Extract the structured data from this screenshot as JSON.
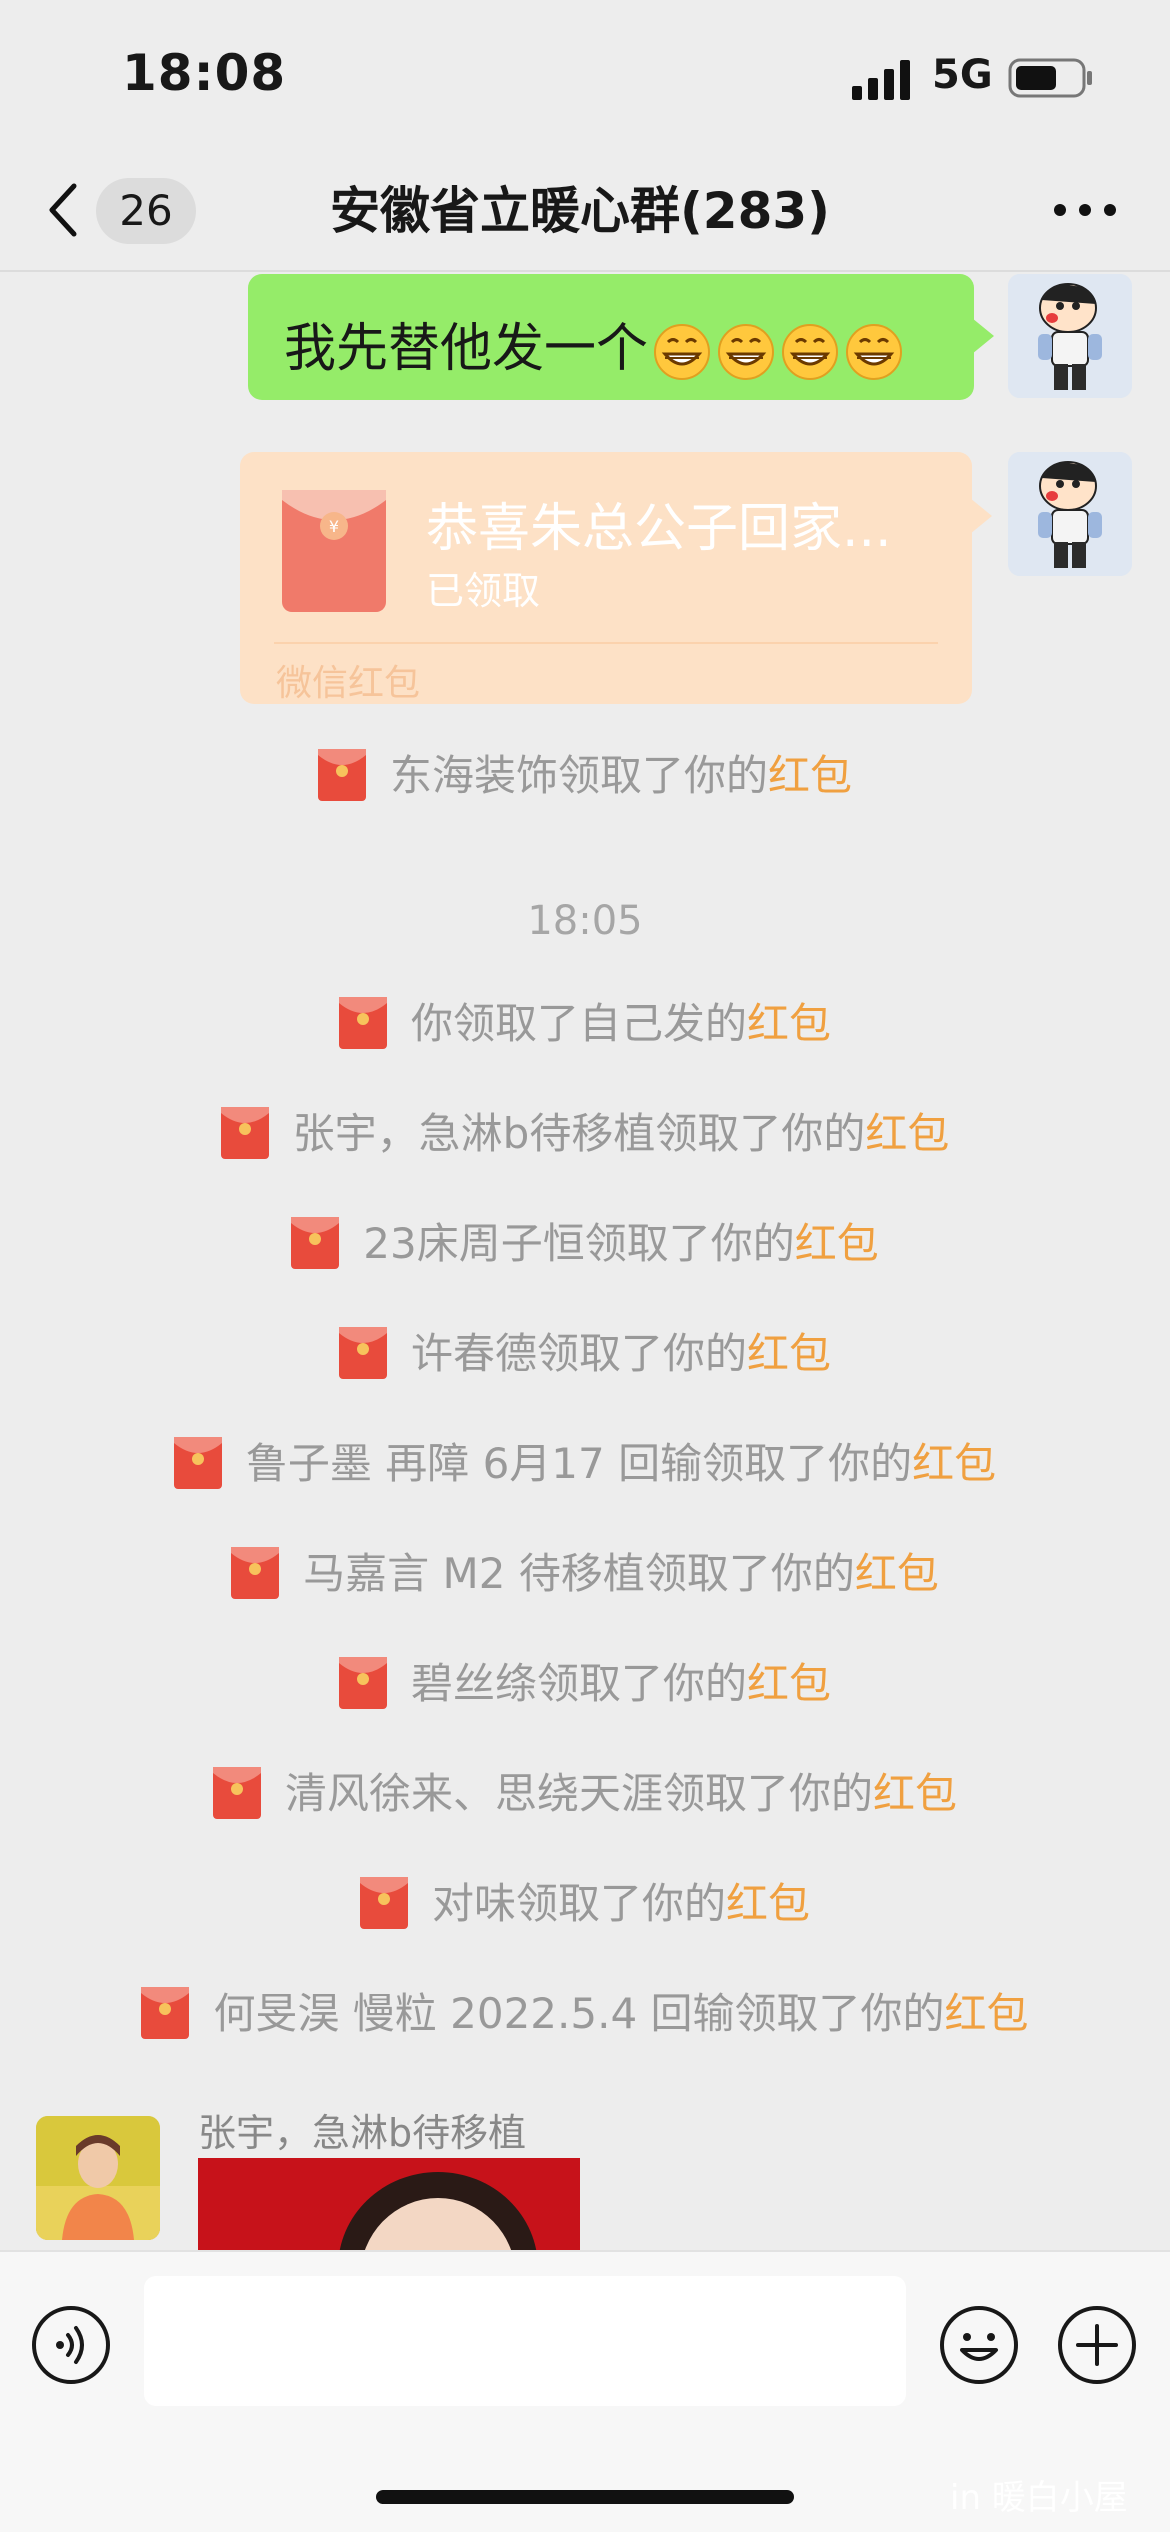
{
  "status_bar": {
    "time": "18:08",
    "network": "5G",
    "icons": [
      "signal-icon",
      "battery-icon"
    ]
  },
  "nav": {
    "back_icon": "chevron-left-icon",
    "unread_count": "26",
    "title": "安徽省立暖心群(283)",
    "more_icon": "more-dots-icon"
  },
  "messages": {
    "sent_text": "我先替他发一个",
    "sent_text_emoji": "grinning-face-icon",
    "sent_text_emoji_count": 4,
    "red_packet": {
      "title": "恭喜朱总公子回家...",
      "status": "已领取",
      "footer": "微信红包"
    },
    "time_divider": "18:05",
    "claim_lines": [
      {
        "prefix": "东海装饰领取了你的",
        "link": "红包"
      },
      {
        "prefix": "你领取了自己发的",
        "link": "红包"
      },
      {
        "prefix": "张宇，急淋b待移植领取了你的",
        "link": "红包"
      },
      {
        "prefix": "23床周子恒领取了你的",
        "link": "红包"
      },
      {
        "prefix": "许春德领取了你的",
        "link": "红包"
      },
      {
        "prefix": "鲁子墨 再障 6月17 回输领取了你的",
        "link": "红包"
      },
      {
        "prefix": "马嘉言 M2 待移植领取了你的",
        "link": "红包"
      },
      {
        "prefix": "碧丝绦领取了你的",
        "link": "红包"
      },
      {
        "prefix": "清风徐来、思绕天涯领取了你的",
        "link": "红包"
      },
      {
        "prefix": "对味领取了你的",
        "link": "红包"
      },
      {
        "prefix": "何旻淏  慢粒  2022.5.4 回输领取了你的",
        "link": "红包"
      }
    ],
    "incoming": {
      "sender_name": "张宇，急淋b待移植"
    }
  },
  "input_bar": {
    "voice_icon": "voice-icon",
    "input_value": "",
    "emoji_icon": "smiley-icon",
    "plus_icon": "plus-icon"
  },
  "watermark": "in 暖白小屋",
  "colors": {
    "sent_bubble": "#95ec69",
    "red_packet_claimed": "#fde1c6",
    "red_packet_link": "#f0a040",
    "background": "#ededed"
  }
}
